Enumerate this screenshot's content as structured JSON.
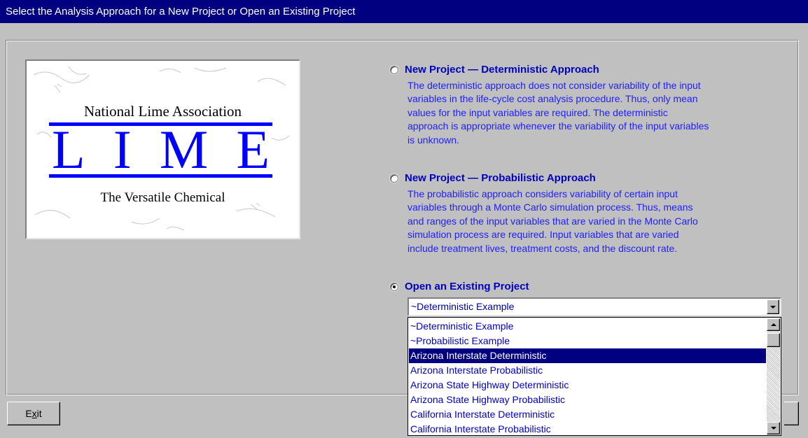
{
  "window": {
    "title": "Select the Analysis Approach for a New Project or Open an Existing Project"
  },
  "logo": {
    "association": "National Lime Association",
    "letters": [
      "L",
      "I",
      "M",
      "E"
    ],
    "tagline": "The Versatile Chemical"
  },
  "options": [
    {
      "label": "New Project — Deterministic Approach",
      "selected": false,
      "description": [
        "The deterministic approach does not consider variability of the input",
        "variables in the life-cycle cost analysis procedure.  Thus, only mean",
        "values for the input variables are required.  The deterministic",
        "approach is appropriate whenever the variability of the input variables",
        "is unknown."
      ]
    },
    {
      "label": "New Project — Probabilistic Approach",
      "selected": false,
      "description": [
        "The probabilistic approach considers variability of certain input",
        "variables through a Monte Carlo simulation process.  Thus, means",
        "and ranges of the input variables that are varied in the Monte Carlo",
        "simulation process are required.  Input variables that are varied",
        "include treatment lives, treatment costs, and the discount rate."
      ]
    },
    {
      "label": "Open an Existing Project",
      "selected": true
    }
  ],
  "project_combo": {
    "value": "~Deterministic Example",
    "items": [
      "~Deterministic Example",
      "~Probabilistic Example",
      "Arizona Interstate Deterministic",
      "Arizona Interstate Probabilistic",
      "Arizona State Highway Deterministic",
      "Arizona State Highway Probabilistic",
      "California Interstate Deterministic",
      "California Interstate Probabilistic"
    ],
    "highlighted_item": "Arizona Interstate Deterministic"
  },
  "buttons": {
    "exit_prefix": "E",
    "exit_mnemonic": "x",
    "exit_suffix": "it"
  },
  "colors": {
    "title_bar": "#000080",
    "face": "#c0c0c0",
    "option_label": "#0000c0",
    "description_text": "#2020ff",
    "logo_blue": "#0000ff",
    "selection": "#000080"
  }
}
